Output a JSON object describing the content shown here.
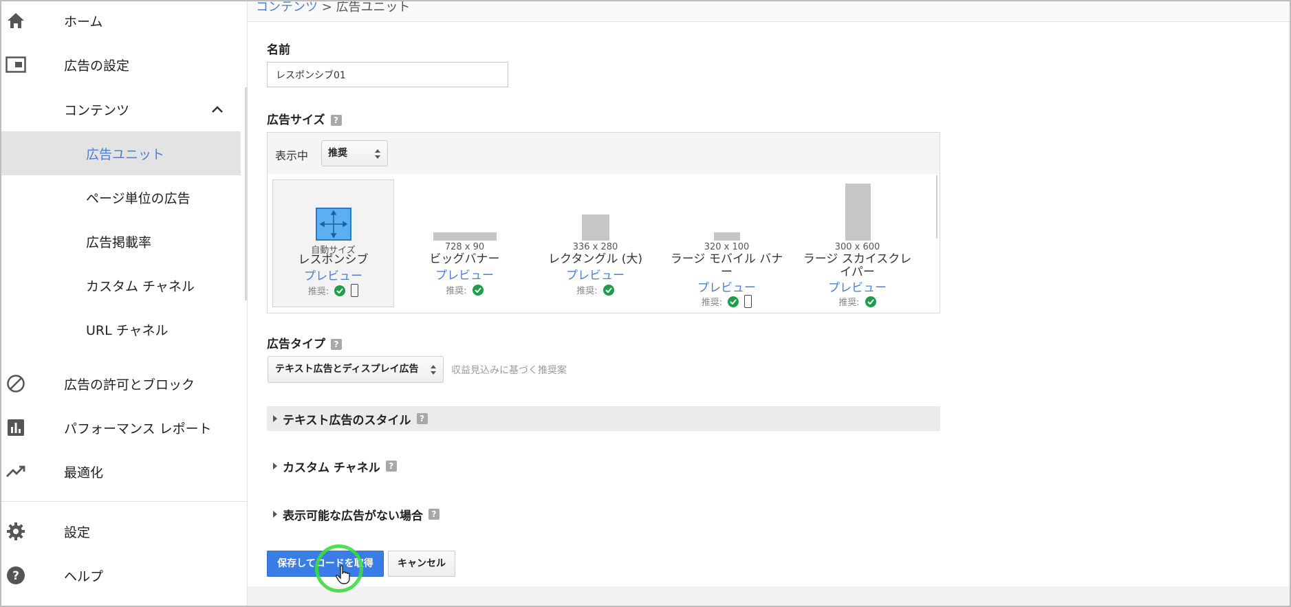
{
  "sidebar": {
    "items": [
      {
        "label": "ホーム",
        "icon": "home-icon"
      },
      {
        "label": "広告の設定",
        "icon": "ad-settings-icon"
      },
      {
        "label": "コンテンツ",
        "icon": "chevron-up-icon"
      },
      {
        "label": "広告ユニット"
      },
      {
        "label": "ページ単位の広告"
      },
      {
        "label": "広告掲載率"
      },
      {
        "label": "カスタム チャネル"
      },
      {
        "label": "URL チャネル"
      },
      {
        "label": "広告の許可とブロック",
        "icon": "block-icon"
      },
      {
        "label": "パフォーマンス レポート",
        "icon": "bar-chart-icon"
      },
      {
        "label": "最適化",
        "icon": "trending-up-icon"
      },
      {
        "label": "設定",
        "icon": "gear-icon"
      },
      {
        "label": "ヘルプ",
        "icon": "help-icon"
      }
    ]
  },
  "breadcrumb": {
    "parent": "コンテンツ",
    "separator": ">",
    "current": "広告ユニット"
  },
  "name_section": {
    "label": "名前",
    "value": "レスポンシブ01"
  },
  "size_section": {
    "label": "広告サイズ",
    "help": "?",
    "showing_label": "表示中",
    "filter_value": "推奨",
    "cards": [
      {
        "dim": "自動サイズ",
        "name": "レスポンシブ",
        "preview": "プレビュー",
        "rec": "推奨:"
      },
      {
        "dim": "728 x 90",
        "name": "ビッグバナー",
        "preview": "プレビュー",
        "rec": "推奨:"
      },
      {
        "dim": "336 x 280",
        "name": "レクタングル (大)",
        "preview": "プレビュー",
        "rec": "推奨:"
      },
      {
        "dim": "320 x 100",
        "name": "ラージ モバイル バナー",
        "preview": "プレビュー",
        "rec": "推奨:"
      },
      {
        "dim": "300 x 600",
        "name": "ラージ スカイスクレイパー",
        "preview": "プレビュー",
        "rec": "推奨:"
      }
    ]
  },
  "type_section": {
    "label": "広告タイプ",
    "help": "?",
    "value": "テキスト広告とディスプレイ広告",
    "hint": "収益見込みに基づく推奨案"
  },
  "collapsibles": [
    {
      "label": "テキスト広告のスタイル",
      "help": "?"
    },
    {
      "label": "カスタム チャネル",
      "help": "?"
    },
    {
      "label": "表示可能な広告がない場合",
      "help": "?"
    }
  ],
  "actions": {
    "save_label": "保存してコードを取得",
    "cancel_label": "キャンセル"
  },
  "colors": {
    "accent": "#3b7de6",
    "link": "#4a7fd6",
    "check": "#1e9e4a",
    "highlight": "#3ddc3d"
  }
}
